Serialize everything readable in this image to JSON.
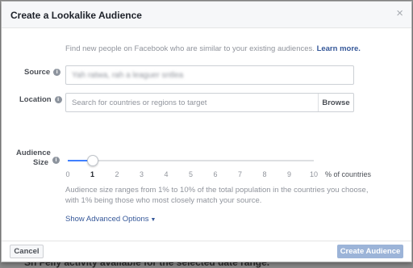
{
  "background": {
    "text": "Sn Feiiy activity available for the selected date range."
  },
  "dialog": {
    "title": "Create a Lookalike Audience",
    "close": "×",
    "intro_text": "Find new people on Facebook who are similar to your existing audiences.",
    "intro_link": "Learn more.",
    "source": {
      "label": "Source",
      "value": "Yah ratwa, rah a leaguer sntlea"
    },
    "location": {
      "label": "Location",
      "placeholder": "Search for countries or regions to target",
      "browse": "Browse"
    },
    "audience_size": {
      "label_line1": "Audience",
      "label_line2": "Size",
      "selected_percent": 1,
      "min": 0,
      "max": 10,
      "ticks": [
        "0",
        "1",
        "2",
        "3",
        "4",
        "5",
        "6",
        "7",
        "8",
        "9",
        "10"
      ],
      "unit_label": "% of countries",
      "description": "Audience size ranges from 1% to 10% of the total population in the countries you choose, with 1% being those who most closely match your source."
    },
    "advanced_options": "Show Advanced Options",
    "footer": {
      "cancel": "Cancel",
      "create": "Create Audience"
    }
  },
  "colors": {
    "link": "#365899",
    "slider_accent": "#4080ff",
    "primary_disabled": "#9cb4d8"
  }
}
